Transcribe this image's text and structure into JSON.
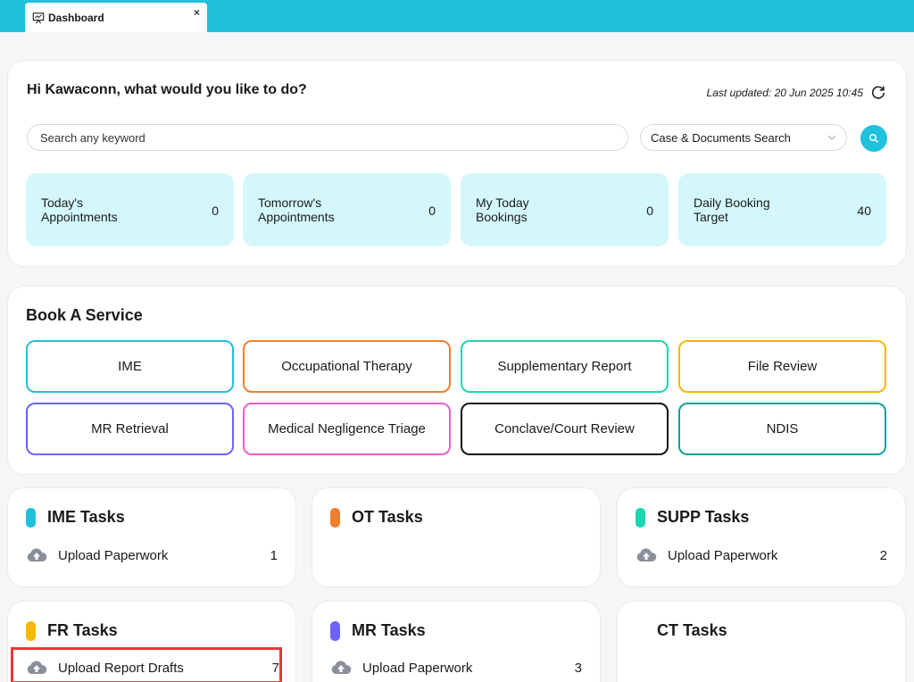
{
  "tab": {
    "label": "Dashboard",
    "close": "×"
  },
  "welcome": {
    "greeting": "Hi Kawaconn, what would you like to do?",
    "last_updated": "Last updated: 20 Jun 2025 10:45"
  },
  "search": {
    "placeholder": "Search any keyword",
    "select_value": "Case & Documents Search"
  },
  "stats": [
    {
      "label": "Today's Appointments",
      "value": "0"
    },
    {
      "label": "Tomorrow's Appointments",
      "value": "0"
    },
    {
      "label": "My Today Bookings",
      "value": "0"
    },
    {
      "label": "Daily Booking Target",
      "value": "40"
    }
  ],
  "book": {
    "title": "Book A Service",
    "services": [
      {
        "label": "IME",
        "color": "#1fc1db"
      },
      {
        "label": "Occupational Therapy",
        "color": "#f07f2f"
      },
      {
        "label": "Supplementary Report",
        "color": "#1dd6b0"
      },
      {
        "label": "File Review",
        "color": "#f5b800"
      },
      {
        "label": "MR Retrieval",
        "color": "#6c63ff"
      },
      {
        "label": "Medical Negligence Triage",
        "color": "#ea5fc9"
      },
      {
        "label": "Conclave/Court Review",
        "color": "#111111"
      },
      {
        "label": "NDIS",
        "color": "#159e9a"
      }
    ]
  },
  "tasks": [
    {
      "title": "IME Tasks",
      "color": "#1fc1db",
      "item": "Upload Paperwork",
      "count": "1"
    },
    {
      "title": "OT Tasks",
      "color": "#f07f2f",
      "item": "",
      "count": ""
    },
    {
      "title": "SUPP Tasks",
      "color": "#1dd6b0",
      "item": "Upload Paperwork",
      "count": "2"
    },
    {
      "title": "FR Tasks",
      "color": "#f5b800",
      "item": "Upload Report Drafts",
      "count": "7"
    },
    {
      "title": "MR Tasks",
      "color": "#6c63ff",
      "item": "Upload Paperwork",
      "count": "3"
    },
    {
      "title": "CT Tasks",
      "color": "",
      "item": "",
      "count": ""
    }
  ]
}
